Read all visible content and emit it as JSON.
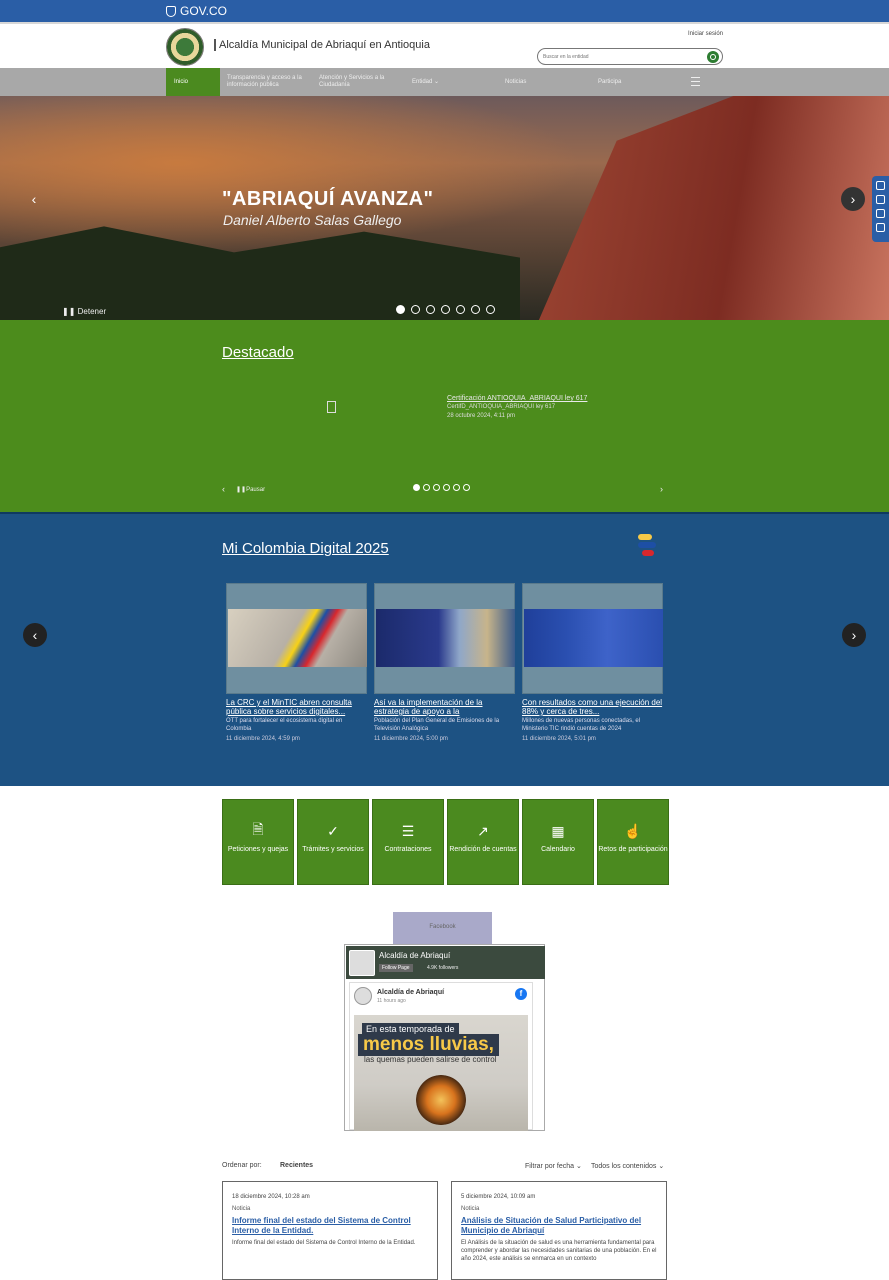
{
  "govbar": {
    "label": "GOV.CO"
  },
  "header": {
    "site_name": "Alcaldía Municipal de Abriaquí en Antioquia",
    "login": "Iniciar sesión",
    "search_placeholder": "Buscar en la entidad"
  },
  "nav": {
    "items": [
      {
        "label": "Inicio"
      },
      {
        "label": "Transparencia y acceso a la información pública"
      },
      {
        "label": "Atención y Servicios a la Ciudadanía"
      },
      {
        "label": "Entidad ⌄"
      },
      {
        "label": "Noticias"
      },
      {
        "label": "Participa"
      }
    ]
  },
  "hero": {
    "title": "\"ABRIAQUÍ AVANZA\"",
    "subtitle": "Daniel Alberto Salas Gallego",
    "stop_label": "Detener",
    "slide_count": 7,
    "active_slide": 0
  },
  "destacado": {
    "title": "Destacado",
    "card_title": "Certificación ANTIOQUIA_ABRIAQUI ley 617",
    "card_sub": "CertifD_ANTIOQUIA_ABRIAQUI ley 617",
    "card_date": "28 octubre 2024, 4:11 pm",
    "pause_label": "Pausar",
    "slide_count": 6,
    "active_slide": 0
  },
  "digital": {
    "title": "Mi Colombia Digital 2025",
    "cards": [
      {
        "title": "La CRC y el MinTIC abren consulta pública sobre servicios digitales...",
        "desc": "OTT para fortalecer el ecosistema digital en Colombia",
        "date": "11 diciembre 2024, 4:59 pm"
      },
      {
        "title": "Así va la implementación de la estrategia de apoyo a la",
        "desc": "Población del Plan General de Emisiones de la Televisión Analógica",
        "date": "11 diciembre 2024, 5:00 pm"
      },
      {
        "title": "Con resultados como una ejecución del 88% y cerca de tres...",
        "desc": "Millones de nuevas personas conectadas, el Ministerio TIC rindió cuentas de 2024",
        "date": "11 diciembre 2024, 5:01 pm"
      }
    ]
  },
  "quick_links": [
    {
      "label": "Peticiones y quejas",
      "icon": "document-icon"
    },
    {
      "label": "Trámites y servicios",
      "icon": "check-icon"
    },
    {
      "label": "Contrataciones",
      "icon": "checklist-icon"
    },
    {
      "label": "Rendición de cuentas",
      "icon": "chart-icon"
    },
    {
      "label": "Calendario",
      "icon": "calendar-icon"
    },
    {
      "label": "Retos de participación",
      "icon": "hand-icon"
    }
  ],
  "facebook": {
    "tab_label": "Facebook",
    "page_name": "Alcaldía de Abriaquí",
    "follow_label": "Follow Page",
    "followers": "4.9K followers",
    "post_author": "Alcaldía de Abriaquí",
    "post_time": "11 hours ago",
    "image_line1": "En esta temporada de",
    "image_line2": "menos lluvias,",
    "image_line3": "las quemas pueden salirse de control"
  },
  "sort": {
    "label": "Ordenar por:",
    "value": "Recientes",
    "filter_date": "Filtrar por fecha ⌄",
    "filter_content": "Todos los contenidos ⌄"
  },
  "content_cards": [
    {
      "date": "18 diciembre 2024, 10:28 am",
      "category": "Noticia",
      "title": "Informe final del estado del Sistema de Control Interno de la Entidad.",
      "desc": "Informe final del estado del Sistema de Control Interno de la Entidad."
    },
    {
      "date": "5 diciembre 2024, 10:09 am",
      "category": "Noticia",
      "title": "Análisis de Situación de Salud Participativo del Municipio de Abriaquí",
      "desc": "El Análisis de la situación de salud es una herramienta fundamental para comprender y abordar las necesidades sanitarias de una población. En el año 2024, este análisis se enmarca en un contexto"
    }
  ],
  "colors": {
    "gov_blue": "#2a5ea6",
    "green": "#4b8a1f",
    "digital_blue": "#1d5283"
  }
}
